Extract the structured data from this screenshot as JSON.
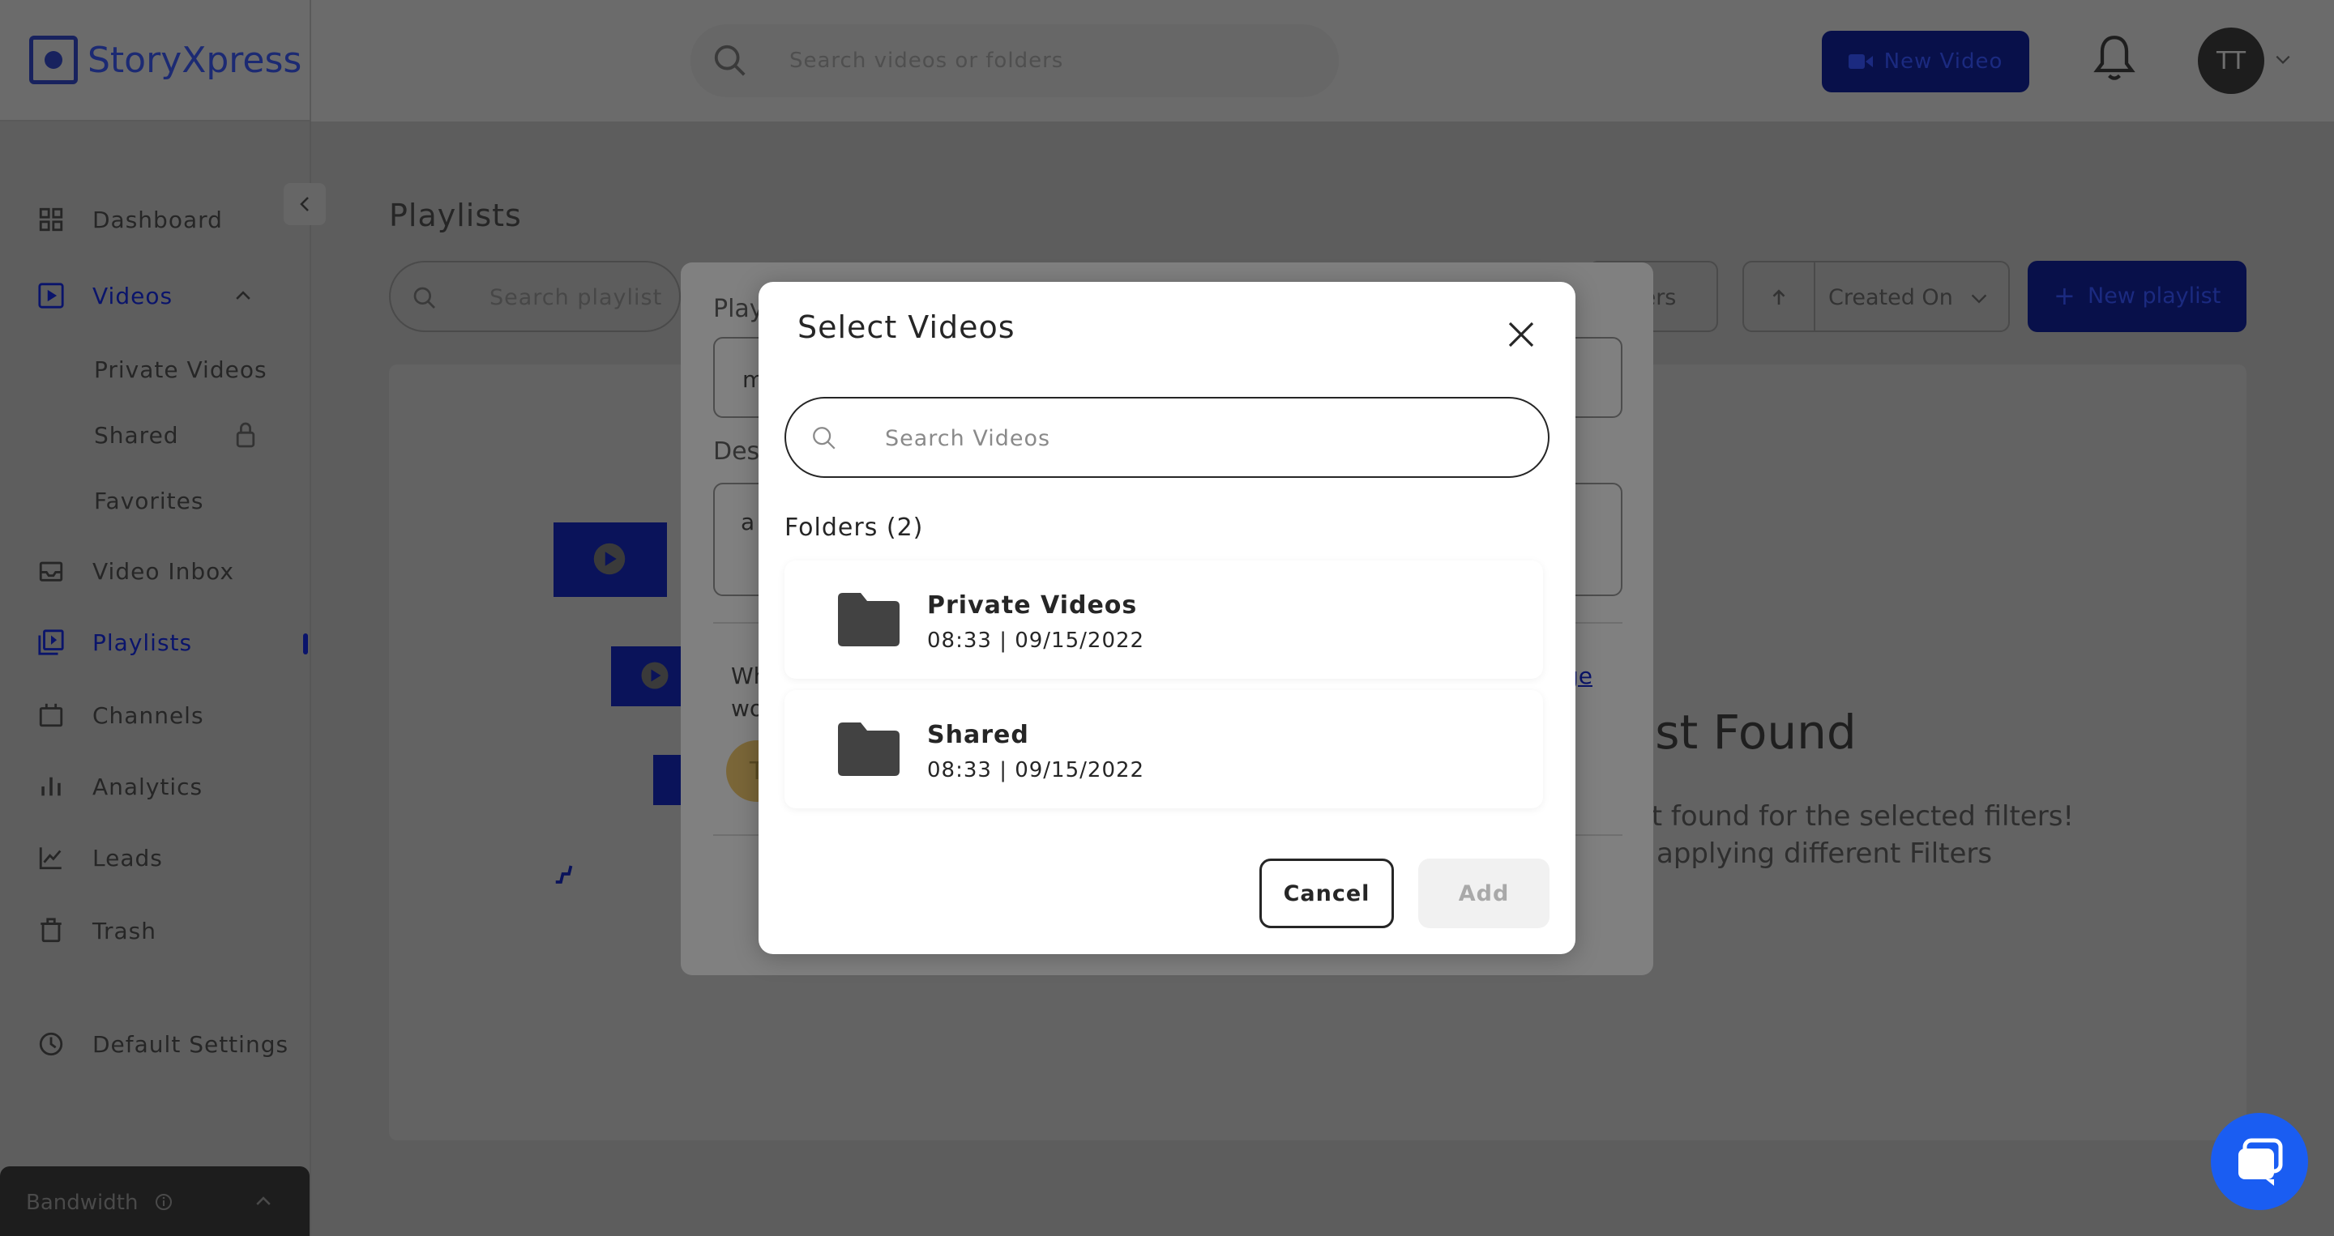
{
  "app": {
    "logo_text": "StoryXpress"
  },
  "header": {
    "search_placeholder": "Search videos or folders",
    "new_video_label": "New Video",
    "avatar_initials": "TT"
  },
  "sidebar": {
    "items": [
      {
        "label": "Dashboard",
        "icon": "grid-icon"
      },
      {
        "label": "Videos",
        "icon": "video-icon"
      },
      {
        "label": "Private Videos"
      },
      {
        "label": "Shared",
        "icon": "lock-icon"
      },
      {
        "label": "Favorites"
      },
      {
        "label": "Video Inbox",
        "icon": "inbox-icon"
      },
      {
        "label": "Playlists",
        "icon": "playlist-icon"
      },
      {
        "label": "Channels",
        "icon": "channels-icon"
      },
      {
        "label": "Analytics",
        "icon": "analytics-icon"
      },
      {
        "label": "Leads",
        "icon": "leads-icon"
      },
      {
        "label": "Trash",
        "icon": "trash-icon"
      },
      {
        "label": "Default Settings",
        "icon": "settings-icon"
      }
    ],
    "bandwidth_label": "Bandwidth"
  },
  "main": {
    "title": "Playlists",
    "search_placeholder": "Search playlist",
    "filters_label": "ters",
    "sort_label": "Created On",
    "new_playlist_label": "New playlist",
    "empty_title": "list Found",
    "empty_line1": "st found for the selected filters!",
    "empty_line2": "applying different Filters"
  },
  "playlist_modal": {
    "name_label": "Play",
    "name_value": "m",
    "desc_label": "Des",
    "desc_value": "a",
    "text_line1": "Wh",
    "text_line2": "wo",
    "link_text": "ge",
    "avatar_letter": "T"
  },
  "select_modal": {
    "title": "Select Videos",
    "search_placeholder": "Search Videos",
    "folders_heading": "Folders (2)",
    "folders": [
      {
        "name": "Private Videos",
        "meta": "08:33 | 09/15/2022"
      },
      {
        "name": "Shared",
        "meta": "08:33 | 09/15/2022"
      }
    ],
    "cancel_label": "Cancel",
    "add_label": "Add"
  },
  "colors": {
    "brand": "#1c2a73",
    "overlay": "#5d5d5d",
    "modal_bg": "#ffffff",
    "text": "#262626",
    "chat_fab": "#1a5df2"
  }
}
